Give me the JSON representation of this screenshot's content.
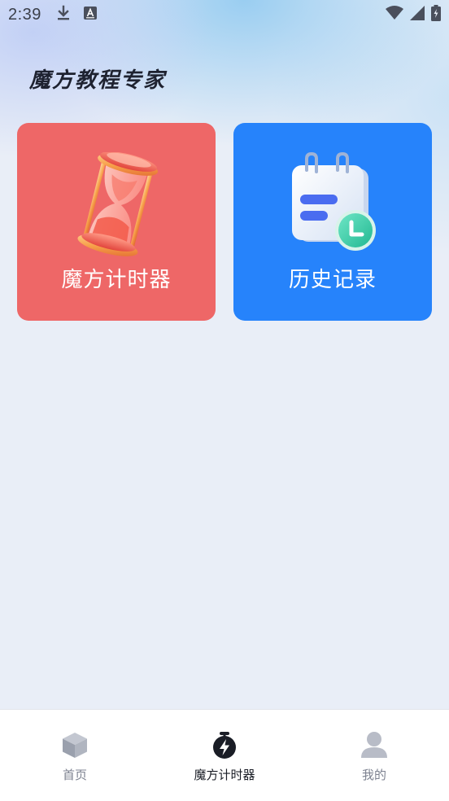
{
  "status_bar": {
    "time": "2:39",
    "icons": [
      "download-icon",
      "font-icon",
      "wifi-icon",
      "signal-icon",
      "battery-icon"
    ]
  },
  "header": {
    "title": "魔方教程专家"
  },
  "cards": [
    {
      "label": "魔方计时器",
      "icon": "hourglass-icon",
      "color": "#ee6767"
    },
    {
      "label": "历史记录",
      "icon": "calendar-clock-icon",
      "color": "#2683fb"
    }
  ],
  "bottom_nav": {
    "items": [
      {
        "label": "首页",
        "icon": "cube-icon",
        "active": false
      },
      {
        "label": "魔方计时器",
        "icon": "stopwatch-icon",
        "active": true
      },
      {
        "label": "我的",
        "icon": "user-icon",
        "active": false
      }
    ],
    "active_color": "#1a1d26",
    "inactive_color": "#7d8290"
  }
}
